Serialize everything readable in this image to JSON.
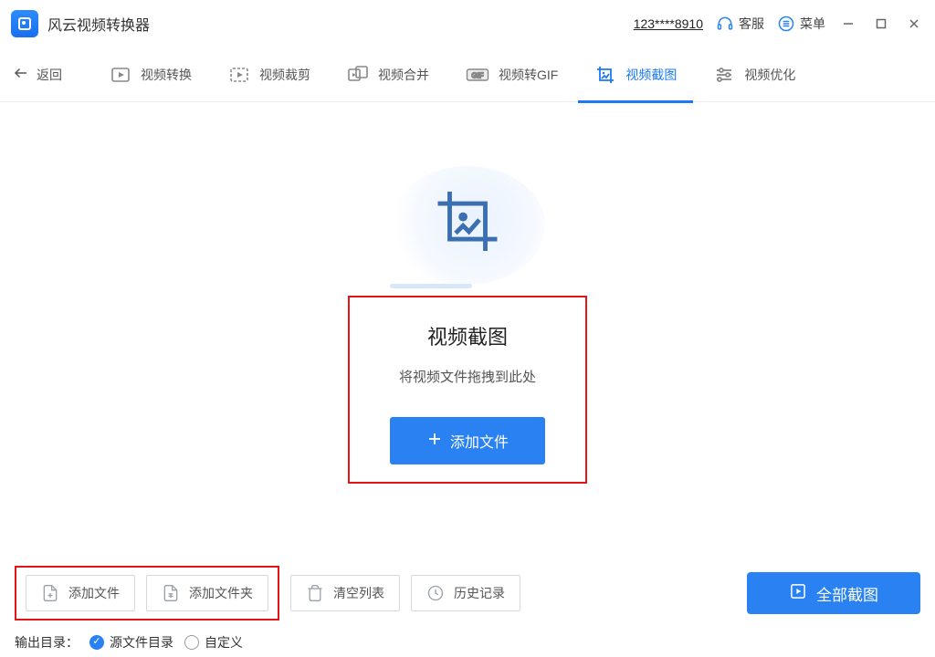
{
  "app": {
    "title": "风云视频转换器"
  },
  "titlebar": {
    "account": "123****8910",
    "support_label": "客服",
    "menu_label": "菜单"
  },
  "toolbar": {
    "back": "返回",
    "items": [
      {
        "label": "视频转换"
      },
      {
        "label": "视频裁剪"
      },
      {
        "label": "视频合并"
      },
      {
        "label": "视频转GIF"
      },
      {
        "label": "视频截图"
      },
      {
        "label": "视频优化"
      }
    ],
    "active_index": 4
  },
  "drop": {
    "title": "视频截图",
    "subtitle": "将视频文件拖拽到此处",
    "button": "添加文件"
  },
  "bottom": {
    "add_file": "添加文件",
    "add_folder": "添加文件夹",
    "clear_list": "清空列表",
    "history": "历史记录",
    "capture_all": "全部截图"
  },
  "output": {
    "label": "输出目录：",
    "opt_source": "源文件目录",
    "opt_custom": "自定义",
    "selected": "source"
  }
}
